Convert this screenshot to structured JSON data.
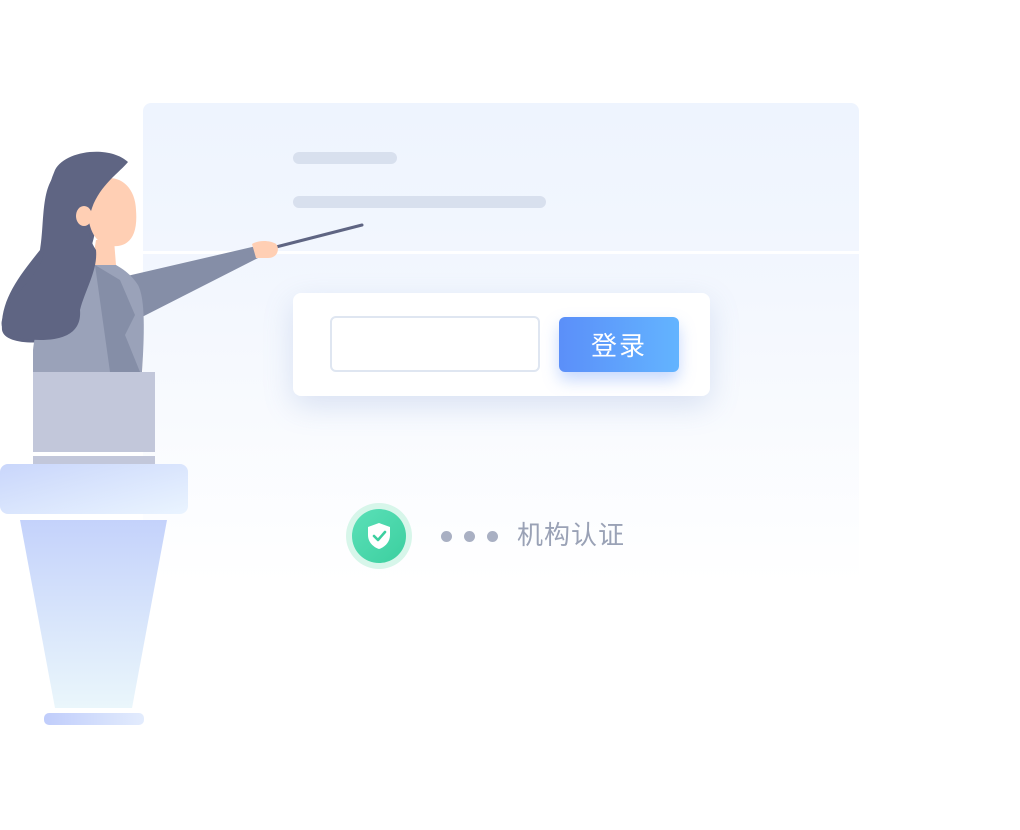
{
  "login": {
    "input_value": "",
    "button_label": "登录"
  },
  "certification": {
    "label": "机构认证",
    "icon": "shield-check-icon",
    "dot_count": 3
  },
  "illustration": {
    "subject": "presenter-with-pointer-at-podium"
  },
  "colors": {
    "accent": "#5b8ff9",
    "success": "#3ccf9f",
    "panel": "#eef4fe",
    "muted_text": "#9aa2b6"
  }
}
